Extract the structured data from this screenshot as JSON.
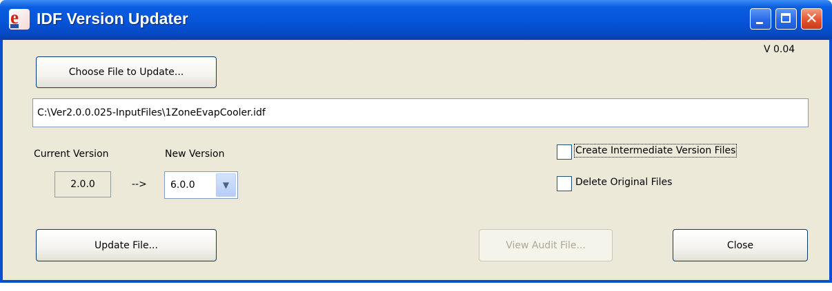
{
  "window": {
    "title": "IDF Version Updater",
    "icon_name": "energyplus-e-icon",
    "version_label": "V 0.04"
  },
  "titlebar_buttons": {
    "minimize_icon": "minimize-icon",
    "maximize_icon": "maximize-icon",
    "close_icon": "close-icon",
    "close_glyph": "✕"
  },
  "file": {
    "choose_button_label": "Choose File to Update...",
    "path_value": "C:\\Ver2.0.0.025-InputFiles\\1ZoneEvapCooler.idf"
  },
  "versions": {
    "current_label": "Current Version",
    "current_value": "2.0.0",
    "arrow_text": "-->",
    "new_label": "New Version",
    "new_value": "6.0.0",
    "dropdown_glyph": "▼"
  },
  "options": {
    "create_intermediate_label": "Create Intermediate Version Files",
    "create_intermediate_checked": false,
    "delete_original_label": "Delete Original Files",
    "delete_original_checked": false
  },
  "actions": {
    "update_label": "Update File...",
    "view_audit_label": "View Audit File...",
    "view_audit_enabled": false,
    "close_label": "Close"
  },
  "colors": {
    "titlebar": "#0654d8",
    "window_bg": "#ece9d8",
    "close_button": "#e2562e"
  }
}
